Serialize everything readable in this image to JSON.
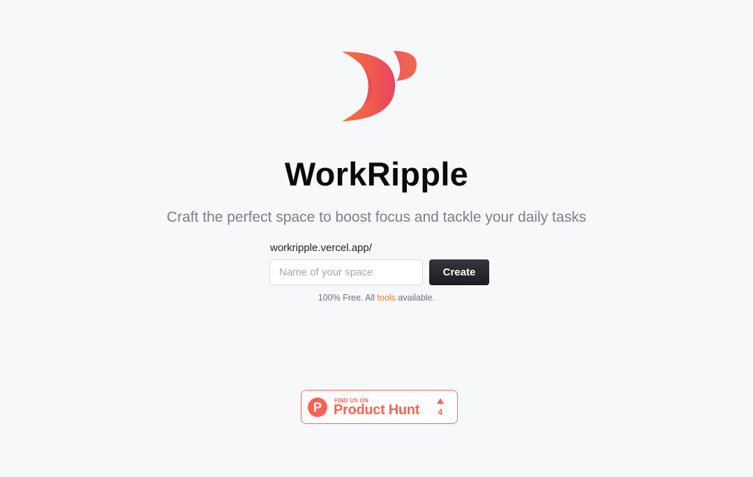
{
  "app": {
    "title": "WorkRipple",
    "tagline": "Craft the perfect space to boost focus and tackle your daily tasks",
    "logo_icon": "workripple-moon-logo-icon",
    "brand_gradient": [
      "#f6733a",
      "#e8465f"
    ]
  },
  "form": {
    "url_prefix": "workripple.vercel.app/",
    "input_placeholder": "Name of your space",
    "input_value": "",
    "create_label": "Create"
  },
  "note": {
    "before": "100% Free. All ",
    "link": "tools",
    "after": " available."
  },
  "product_hunt": {
    "find_text": "FIND US ON",
    "name": "Product Hunt",
    "logo_letter": "P",
    "upvote_icon": "upvote-arrow-icon",
    "upvotes": "4",
    "color": "#ff6154"
  }
}
